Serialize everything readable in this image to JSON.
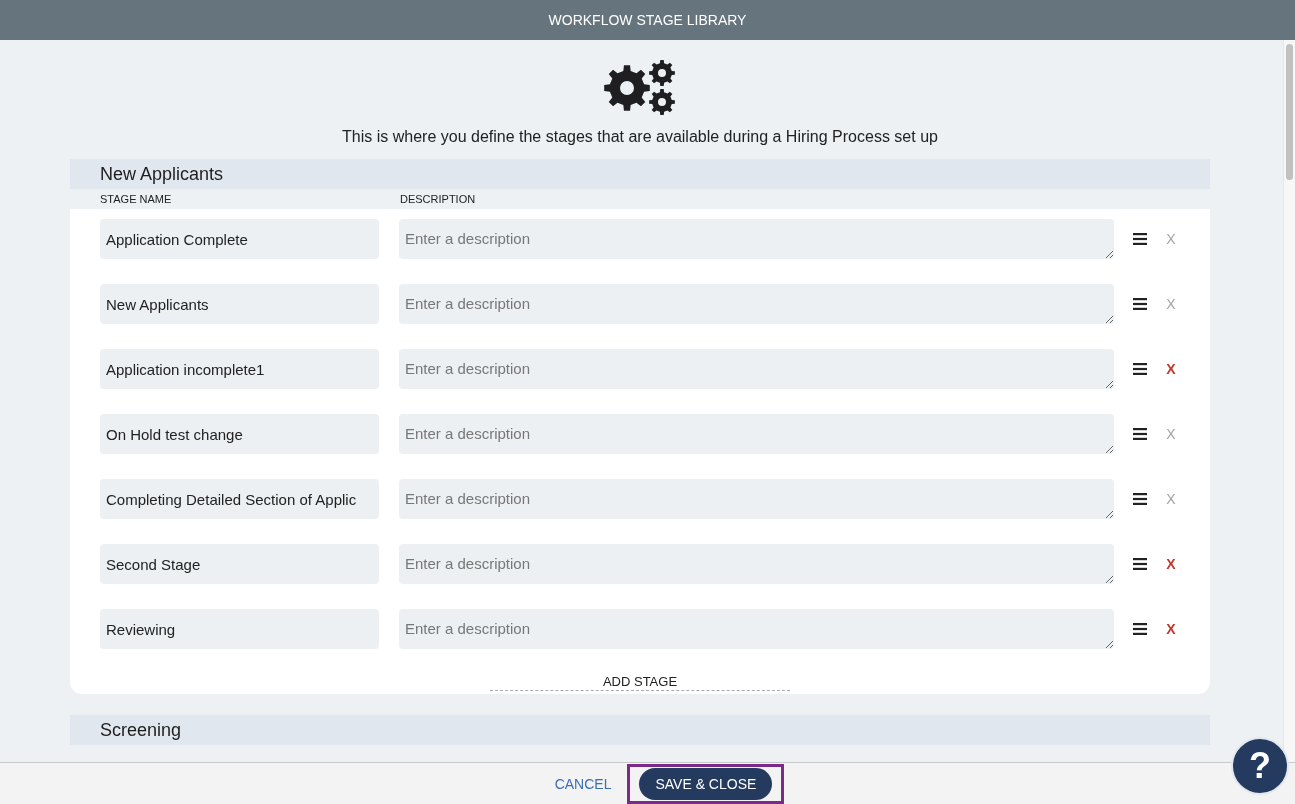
{
  "window": {
    "title": "WORKFLOW STAGE LIBRARY"
  },
  "intro": "This is where you define the stages that are available during a Hiring Process set up",
  "sections": [
    {
      "title": "New Applicants",
      "columns": [
        "STAGE NAME",
        "DESCRIPTION"
      ],
      "stages": [
        {
          "name": "Application Complete",
          "description_placeholder": "Enter a description",
          "remove": "X",
          "disabled": true
        },
        {
          "name": "New Applicants",
          "description_placeholder": "Enter a description",
          "remove": "X",
          "disabled": true
        },
        {
          "name": "Application incomplete1",
          "description_placeholder": "Enter a description",
          "remove": "X",
          "disabled": false
        },
        {
          "name": "On Hold test change",
          "description_placeholder": "Enter a description",
          "remove": "X",
          "disabled": true
        },
        {
          "name": "Completing Detailed Section of Applic",
          "description_placeholder": "Enter a description",
          "remove": "X",
          "disabled": true
        },
        {
          "name": "Second Stage",
          "description_placeholder": "Enter a description",
          "remove": "X",
          "disabled": false
        },
        {
          "name": "Reviewing",
          "description_placeholder": "Enter a description",
          "remove": "X",
          "disabled": false
        }
      ],
      "add_label": "ADD STAGE"
    },
    {
      "title": "Screening"
    }
  ],
  "footer": {
    "cancel": "CANCEL",
    "save": {
      "label": "SAVE & CLOSE",
      "focused": true
    }
  },
  "help": {
    "label": "?"
  }
}
